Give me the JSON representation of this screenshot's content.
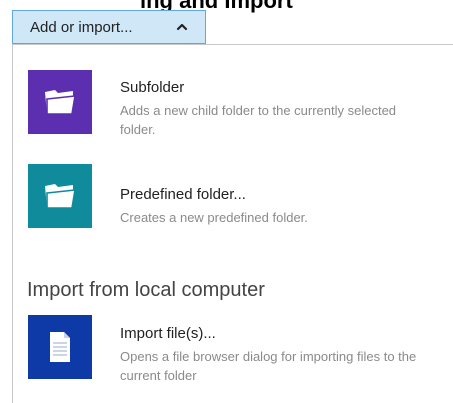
{
  "header": {
    "partial_heading": "ing and Import"
  },
  "dropdown": {
    "label": "Add or import...",
    "expanded": true,
    "chevron_icon": "chevron-up-icon"
  },
  "menu": {
    "items": [
      {
        "title": "Subfolder",
        "description": "Adds a new child folder to the currently selected folder.",
        "tile_color": "#5b2fb0",
        "icon": "folder-icon"
      },
      {
        "title": "Predefined folder...",
        "description": "Creates a new predefined folder.",
        "tile_color": "#0f8b9c",
        "icon": "folder-icon"
      }
    ],
    "section_heading": "Import from local computer",
    "import_item": {
      "title": "Import file(s)...",
      "description": "Opens a file browser dialog for importing files to the current folder",
      "tile_color": "#0e3aa8",
      "icon": "document-icon"
    }
  }
}
